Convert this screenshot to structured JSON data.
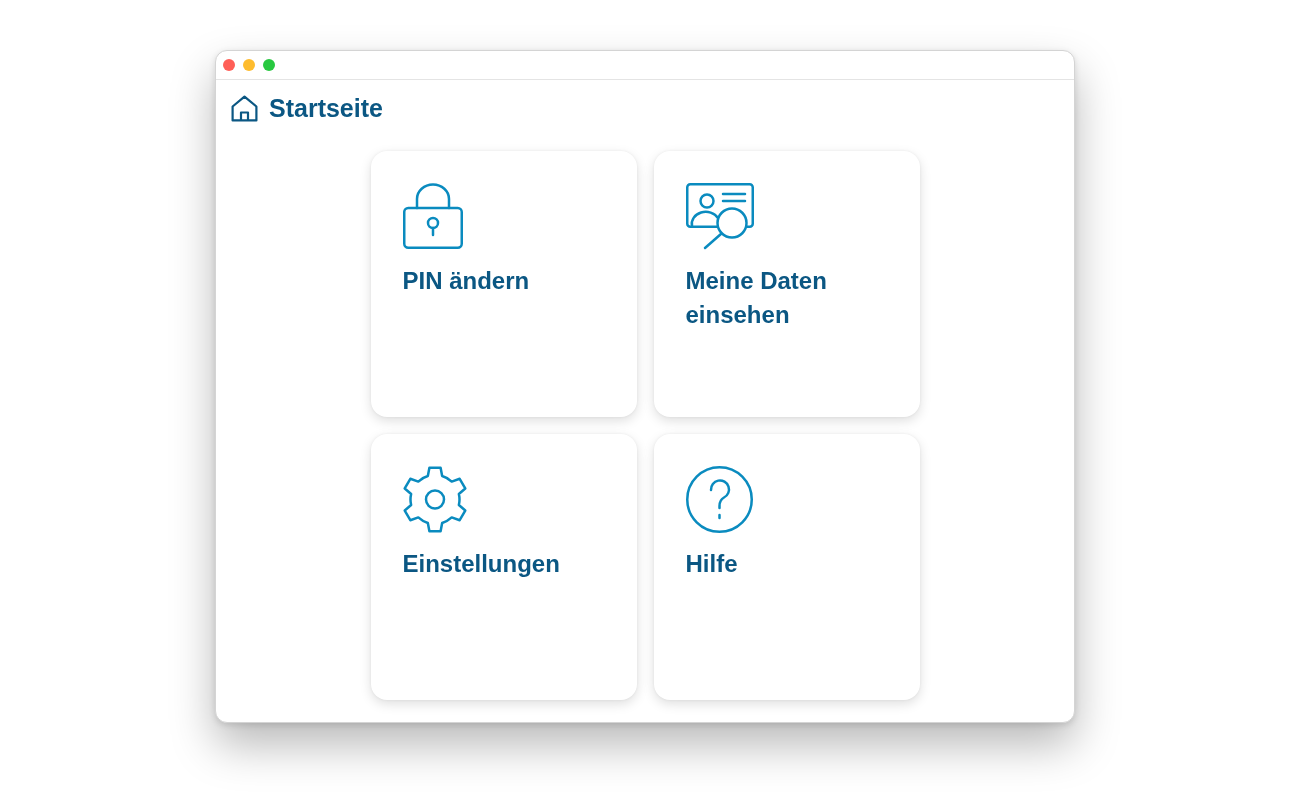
{
  "header": {
    "title": "Startseite"
  },
  "tiles": [
    {
      "kind": "pin",
      "label": "PIN ändern"
    },
    {
      "kind": "data",
      "label": "Meine Daten einsehen"
    },
    {
      "kind": "settings",
      "label": "Einstellungen"
    },
    {
      "kind": "help",
      "label": "Hilfe"
    }
  ]
}
